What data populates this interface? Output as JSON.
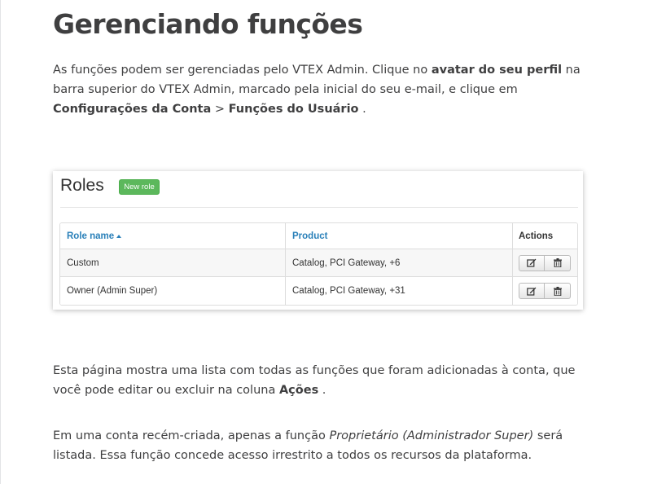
{
  "article": {
    "title": "Gerenciando funções",
    "p1": {
      "t1": "As funções podem ser gerenciadas pelo VTEX Admin. Clique no ",
      "b1": "avatar do seu perfil",
      "t2": " na barra superior do VTEX Admin, marcado pela inicial do seu e-mail, e clique em ",
      "b2": "Configurações da Conta",
      "t3": " > ",
      "b3": "Funções do Usuário",
      "t4": " ."
    },
    "p2": {
      "t1": "Esta página mostra uma lista com todas as funções que foram adicionadas à conta, que você pode editar ou excluir na coluna ",
      "b1": "Ações",
      "t2": " ."
    },
    "p3": {
      "t1": "Em uma conta recém-criada, apenas a função ",
      "i1": "Proprietário (Administrador Super)",
      "t2": " será listada. Essa função concede acesso irrestrito a todos os recursos da plataforma."
    }
  },
  "screenshot": {
    "heading": "Roles",
    "new_role_label": "New role",
    "columns": {
      "role_name": "Role name",
      "product": "Product",
      "actions": "Actions"
    },
    "rows": [
      {
        "role": "Custom",
        "product": "Catalog, PCI Gateway, +6"
      },
      {
        "role": "Owner (Admin Super)",
        "product": "Catalog, PCI Gateway, +31"
      }
    ],
    "icons": {
      "sort": "sort-ascending-icon",
      "edit": "edit-icon",
      "delete": "trash-icon"
    },
    "colors": {
      "new_role_bg": "#5cb85c",
      "header_link": "#2a80b9"
    }
  }
}
